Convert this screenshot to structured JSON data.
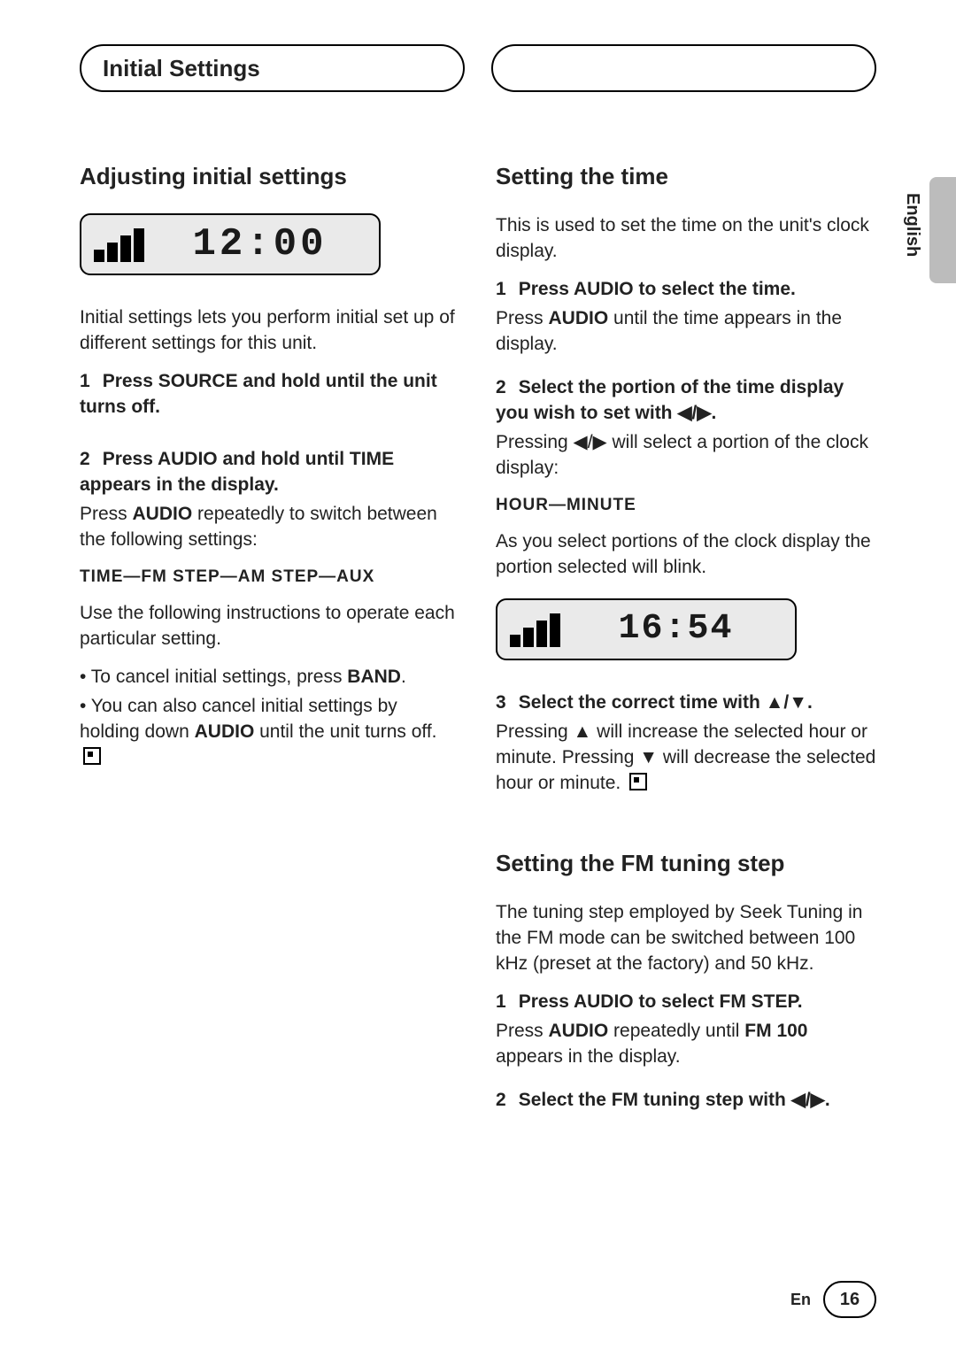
{
  "header": {
    "title": "Initial Settings"
  },
  "side": {
    "language": "English"
  },
  "footer": {
    "lang_abbrev": "En",
    "page_no": "16"
  },
  "left": {
    "h1": "Adjusting initial settings",
    "display_time": "12:00",
    "intro": "Initial settings lets you perform initial set up of different settings for this unit.",
    "step1_num": "1",
    "step1_bold": "Press SOURCE and hold until the unit turns off.",
    "step2_num": "2",
    "step2_bold": "Press AUDIO and hold until TIME appears in the display.",
    "step2_p1a": "Press ",
    "step2_p1_bold": "AUDIO",
    "step2_p1b": " repeatedly to switch between the following settings:",
    "settings_line": "TIME—FM STEP—AM STEP—AUX",
    "use_line": "Use the following instructions to operate each particular setting.",
    "bullet1a": "• To cancel initial settings, press ",
    "bullet1_bold": "BAND",
    "bullet1b": ".",
    "bullet2a": "• You can also cancel initial settings by holding down ",
    "bullet2_bold": "AUDIO",
    "bullet2b": " until the unit turns off."
  },
  "right": {
    "h1": "Setting the time",
    "intro": "This is used to set the time on the unit's clock display.",
    "s1_num": "1",
    "s1_bold": "Press AUDIO to select the time.",
    "s1_p_a": "Press ",
    "s1_p_bold": "AUDIO",
    "s1_p_b": " until the time appears in the display.",
    "s2_num": "2",
    "s2_bold": "Select the portion of the time display you wish to set with ◀/▶.",
    "s2_p": "Pressing ◀/▶ will select a portion of the clock display:",
    "hm_line": "HOUR—MINUTE",
    "s2_p2": "As you select portions of the clock display the portion selected will blink.",
    "display_time": "16:54",
    "s3_num": "3",
    "s3_bold": "Select the correct time with ▲/▼.",
    "s3_p": "Pressing ▲ will increase the selected hour or minute. Pressing ▼ will decrease the selected hour or minute.",
    "h2": "Setting the FM tuning step",
    "fm_intro": "The tuning step employed by Seek Tuning in the FM mode can be switched between 100 kHz (preset at the factory) and 50 kHz.",
    "fm1_num": "1",
    "fm1_bold": "Press AUDIO to select FM STEP.",
    "fm1_p_a": "Press ",
    "fm1_p_bold1": "AUDIO",
    "fm1_p_b": " repeatedly until ",
    "fm1_p_bold2": "FM 100",
    "fm1_p_c": " appears in the display.",
    "fm2_num": "2",
    "fm2_bold": "Select the FM tuning step with ◀/▶."
  }
}
